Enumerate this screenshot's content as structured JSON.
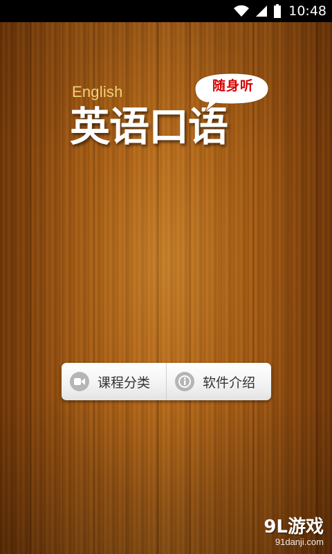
{
  "status_bar": {
    "time": "10:48"
  },
  "logo": {
    "english": "English",
    "title": "英语口语",
    "bubble": "随身听"
  },
  "menu": {
    "courses_label": "课程分类",
    "about_label": "软件介绍"
  },
  "watermark": {
    "main": "9L游戏",
    "sub": "91danji.com"
  },
  "colors": {
    "english_text": "#f2d27a",
    "bubble_text": "#d40000",
    "button_bg": "#f2f2f2",
    "icon_gray": "#b5b5b5"
  },
  "icons": [
    "wifi-icon",
    "signal-icon",
    "battery-icon",
    "video-camera-icon",
    "info-icon"
  ]
}
